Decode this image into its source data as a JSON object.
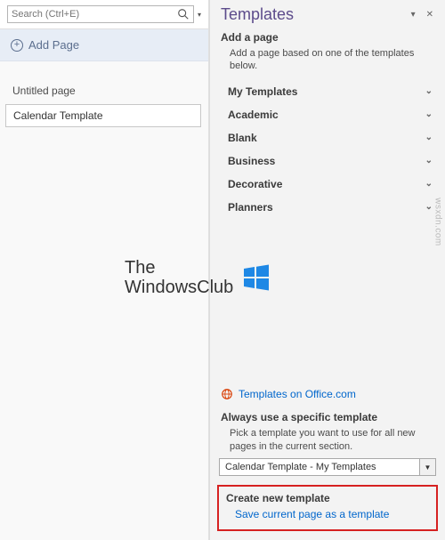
{
  "search": {
    "placeholder": "Search (Ctrl+E)"
  },
  "left": {
    "add_page": "Add Page",
    "pages": {
      "heading": "Untitled page",
      "items": [
        "Calendar Template"
      ]
    }
  },
  "templates_pane": {
    "title": "Templates",
    "add_page_heading": "Add a page",
    "add_page_desc": "Add a page based on one of the templates below.",
    "categories": [
      "My Templates",
      "Academic",
      "Blank",
      "Business",
      "Decorative",
      "Planners"
    ],
    "office_link": "Templates on Office.com",
    "specific_heading": "Always use a specific template",
    "specific_desc": "Pick a template you want to use for all new pages in the current section.",
    "selected_template": "Calendar Template - My Templates",
    "create_heading": "Create new template",
    "create_link": "Save current page as a template"
  },
  "brand": {
    "line1": "The",
    "line2": "WindowsClub"
  },
  "watermark": "wsxdn.com"
}
